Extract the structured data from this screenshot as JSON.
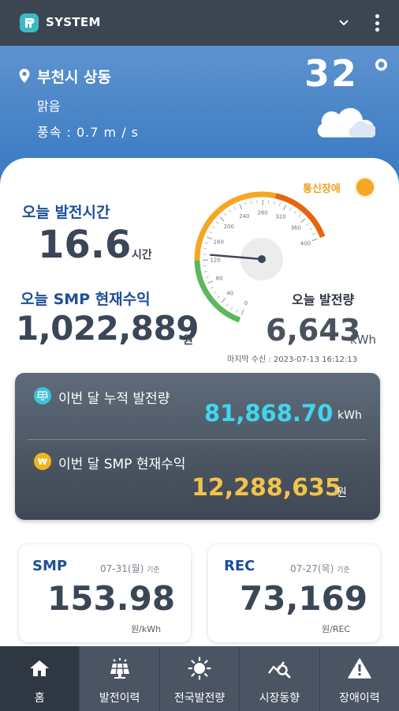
{
  "app": {
    "title": "SYSTEM"
  },
  "weather": {
    "location": "부천시 상동",
    "sky": "맑음",
    "wind": "풍속 :  0.7   m / s",
    "temperature": "32 °",
    "icon": "cloud-icon"
  },
  "status": {
    "comm": "통신장애",
    "comm_color": "#f5a623"
  },
  "today": {
    "gen_time_label": "오늘 발전시간",
    "gen_time_value": "16.6",
    "gen_time_unit": "시간",
    "smp_label": "오늘 SMP 현재수익",
    "smp_value": "1,022,889",
    "smp_unit": "원",
    "gen_label": "오늘 발전량",
    "gen_value": "6,643",
    "gen_unit": "kWh",
    "last_received": "마지막 수신 : 2023-07-13 16:12:13"
  },
  "gauge": {
    "ticks": [
      "0",
      "40",
      "80",
      "120",
      "160",
      "200",
      "240",
      "280",
      "320",
      "360",
      "400"
    ],
    "needle_value": 130,
    "max": 400
  },
  "month": {
    "gen_label": "이번 달 누적 발전량",
    "gen_value": "81,868.70",
    "gen_unit": "kWh",
    "smp_label": "이번 달 SMP 현재수익",
    "smp_value": "12,288,635",
    "smp_unit": "원"
  },
  "cards": {
    "smp": {
      "title": "SMP",
      "date": "07-31(월)",
      "basis": "기준",
      "value": "153.98",
      "unit": "원/kWh"
    },
    "rec": {
      "title": "REC",
      "date": "07-27(목)",
      "basis": "기준",
      "value": "73,169",
      "unit": "원/REC"
    }
  },
  "nav": [
    {
      "label": "홈",
      "icon": "home-icon"
    },
    {
      "label": "발전이력",
      "icon": "solar-panel-icon"
    },
    {
      "label": "전국발전량",
      "icon": "sun-icon"
    },
    {
      "label": "시장동향",
      "icon": "market-trend-icon"
    },
    {
      "label": "장애이력",
      "icon": "warning-icon"
    }
  ],
  "colors": {
    "primary_blue": "#1d4f98",
    "header_bar": "#3c4653",
    "cyan_value": "#40d6ec",
    "gold_value": "#f3c34a"
  }
}
